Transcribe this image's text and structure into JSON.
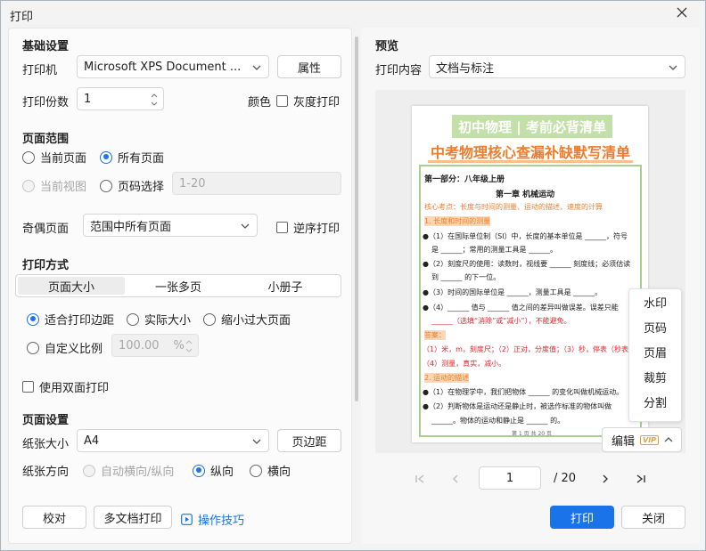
{
  "window": {
    "title": "打印",
    "close": "×"
  },
  "basic": {
    "title": "基础设置",
    "printer_label": "打印机",
    "printer_value": "Microsoft XPS Document ...",
    "properties_btn": "属性",
    "copies_label": "打印份数",
    "copies_value": "1",
    "color_label": "颜色",
    "grayscale_label": "灰度打印"
  },
  "range": {
    "title": "页面范围",
    "current_page": "当前页面",
    "all_pages": "所有页面",
    "current_view": "当前视图",
    "page_select": "页码选择",
    "page_select_placeholder": "1-20",
    "odd_even_label": "奇偶页面",
    "odd_even_value": "范围中所有页面",
    "reverse_label": "逆序打印"
  },
  "method": {
    "title": "打印方式",
    "tabs": [
      "页面大小",
      "一张多页",
      "小册子"
    ],
    "fit_margin": "适合打印边距",
    "actual_size": "实际大小",
    "shrink_large": "缩小过大页面",
    "custom_scale": "自定义比例",
    "scale_value": "100.00",
    "scale_unit": "%",
    "duplex": "使用双面打印"
  },
  "page_setup": {
    "title": "页面设置",
    "paper_size_label": "纸张大小",
    "paper_size_value": "A4",
    "margin_btn": "页边距",
    "orientation_label": "纸张方向",
    "auto_orient": "自动横向/纵向",
    "portrait": "纵向",
    "landscape": "横向"
  },
  "footer": {
    "proofread": "校对",
    "multi_doc": "多文档打印",
    "tips": "操作技巧",
    "print": "打印",
    "close": "关闭"
  },
  "preview": {
    "title": "预览",
    "content_label": "打印内容",
    "content_value": "文档与标注",
    "page_current": "1",
    "page_total": "/ 20",
    "edit_btn": "编辑",
    "vip": "VIP",
    "edit_menu": [
      "水印",
      "页码",
      "页眉",
      "裁剪",
      "分割"
    ]
  },
  "document": {
    "h1": "初中物理 | 考前必背清单",
    "h2": "中考物理核心查漏补缺默写清单",
    "part": "第一部分：八年级上册",
    "chapter": "第一章  机械运动",
    "core": "核心考点：长度与时间的测量、运动的描述、速度的计算",
    "s1": "1. 长度和时间的测量",
    "l1a": "●（1）在国际单位制（SI）中，长度的基本单位是 ______，符号",
    "l1b": "是 ______；常用的测量工具是 ______。",
    "l2a": "●（2）刻度尺的使用：读数时，视线要 ______ 刻度线；必须估读",
    "l2b": "到 ______ 的下一位。",
    "l3": "●（3）时间的国际单位是 ______，测量工具是 ______。",
    "l4a": "●（4）______ 值与 ______ 值之间的差异叫做误差。误差只能",
    "l4b": "______（选填“消除”或“减小”），不能避免。",
    "ans_label": "答案：",
    "ans": "（1）米，m，刻度尺；（2）正对，分度值；（3）秒，停表（秒表）；",
    "ans2": "（4）测量，真实，减小。",
    "s2": "2. 运动的描述",
    "l5": "●（1）在物理学中，我们把物体 ______ 的变化叫做机械运动。",
    "l6a": "●（2）判断物体是运动还是静止时，被选作标准的物体叫做",
    "l6b": "______。物体的运动和静止是 ______ 的。",
    "pageno": "第 1 页 共 20 页"
  }
}
